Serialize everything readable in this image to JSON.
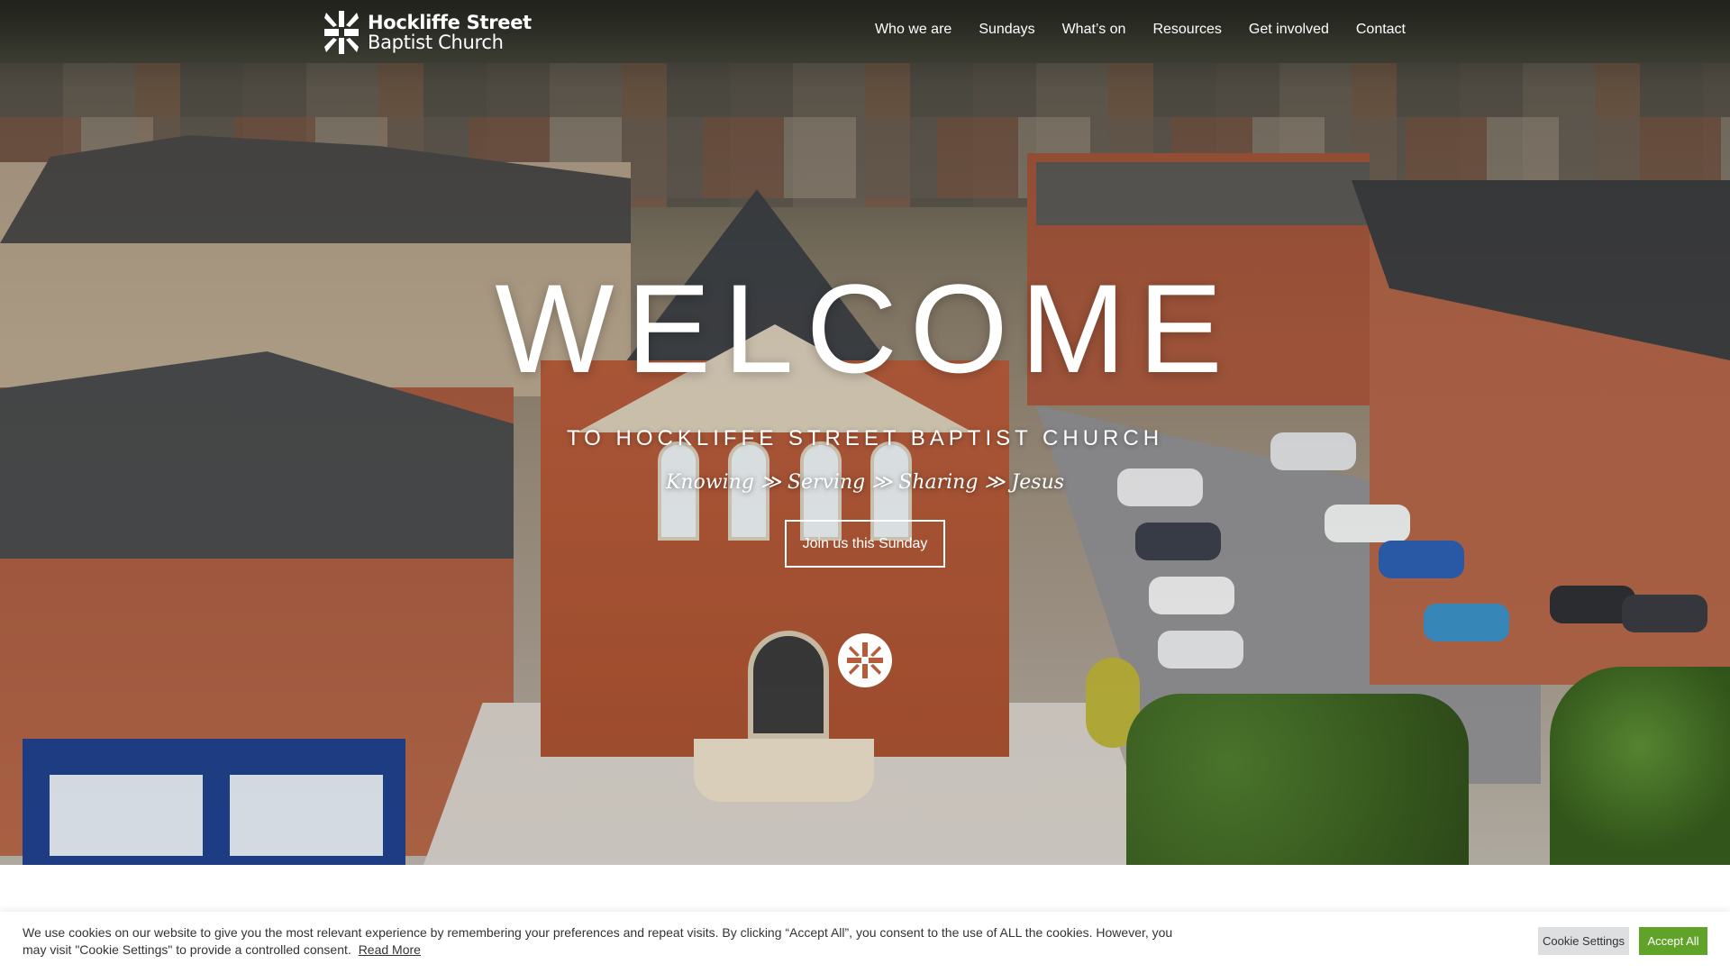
{
  "logo": {
    "line1": "Hockliffe Street",
    "line2": "Baptist Church"
  },
  "nav": {
    "items": [
      {
        "label": "Who we are"
      },
      {
        "label": "Sundays"
      },
      {
        "label": "What’s on"
      },
      {
        "label": "Resources"
      },
      {
        "label": "Get involved"
      },
      {
        "label": "Contact"
      }
    ]
  },
  "hero": {
    "headline": "WELCOME",
    "subheading": "TO HOCKLIFFE STREET BAPTIST CHURCH",
    "tagline": "Knowing ≫ Serving ≫ Sharing ≫ Jesus",
    "cta_label": "Join us this Sunday"
  },
  "cookie": {
    "message": "We use cookies on our website to give you the most relevant experience by remembering your preferences and repeat visits. By clicking “Accept All”, you consent to the use of ALL the cookies. However, you may visit \"Cookie Settings\" to provide a controlled consent.",
    "read_more": "Read More",
    "settings_label": "Cookie Settings",
    "accept_label": "Accept All"
  },
  "colors": {
    "accept_button": "#61a229",
    "settings_button": "#dedfe0",
    "nav_text": "#ffffff"
  },
  "icons": {
    "logo": "church-cross-logo-icon",
    "emblem": "church-cross-emblem-icon"
  }
}
